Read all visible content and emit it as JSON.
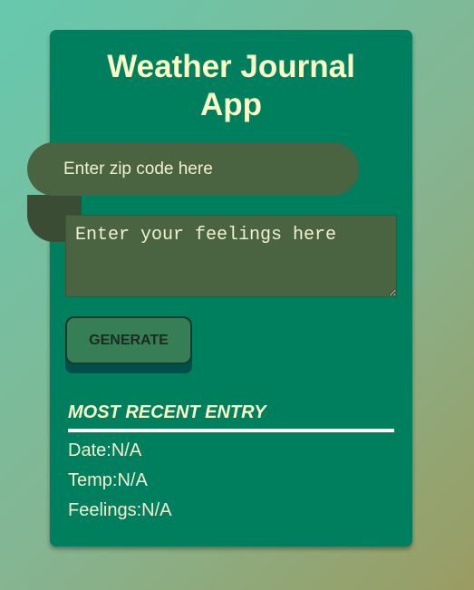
{
  "app": {
    "title_line1": "Weather Journal",
    "title_line2": "App"
  },
  "form": {
    "zip_placeholder": "Enter zip code here",
    "zip_value": "",
    "feelings_placeholder": "Enter your feelings here",
    "feelings_value": "",
    "generate_label": "GENERATE"
  },
  "entry": {
    "heading": "MOST RECENT ENTRY",
    "date_label": "Date:",
    "date_value": "N/A",
    "temp_label": "Temp:",
    "temp_value": "N/A",
    "feelings_label": "Feelings:",
    "feelings_value": "N/A"
  },
  "colors": {
    "card": "#007f5f",
    "title_text": "#fafbc7",
    "input_bg": "#4a6441",
    "button_bg": "#357e56"
  }
}
